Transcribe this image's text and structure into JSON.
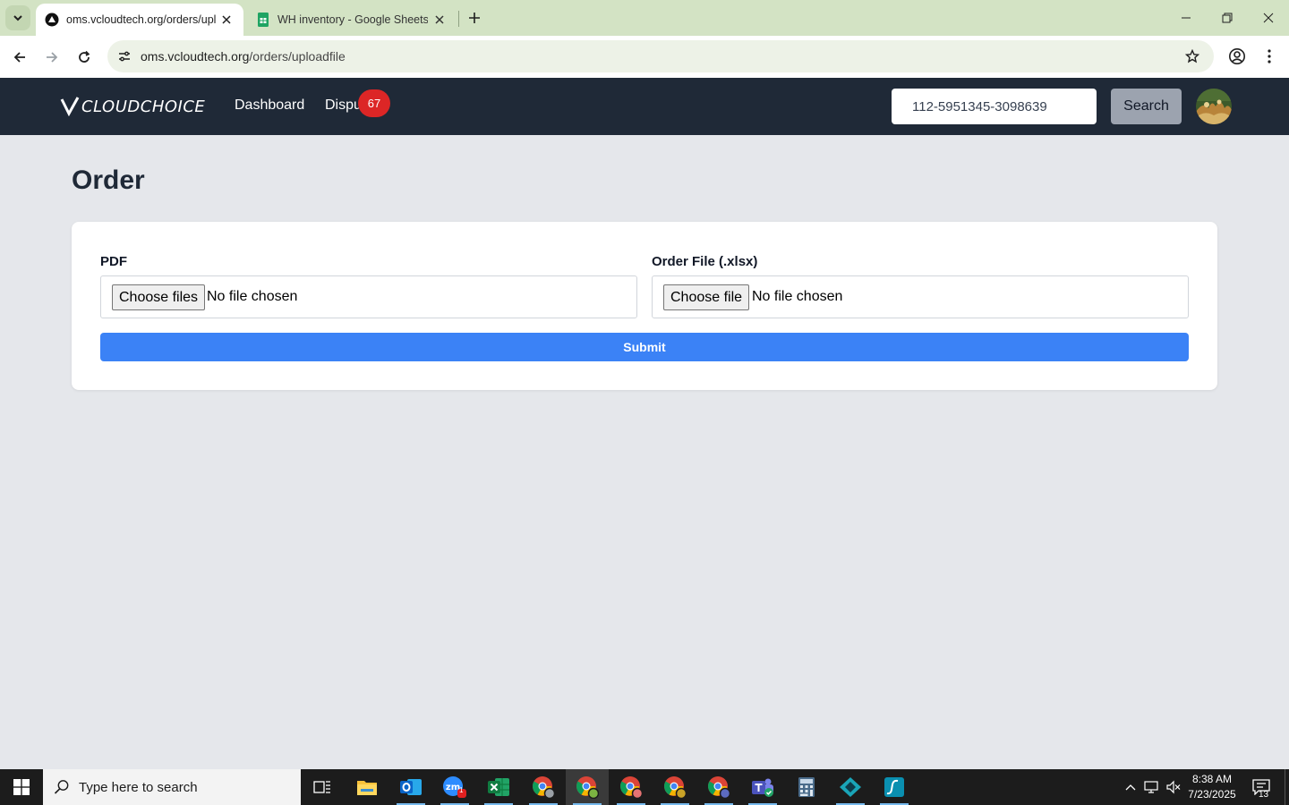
{
  "browser": {
    "tabs": [
      {
        "title": "oms.vcloudtech.org/orders/upl",
        "active": true
      },
      {
        "title": "WH inventory - Google Sheets",
        "active": false
      }
    ],
    "url_host": "oms.vcloudtech.org",
    "url_path": "/orders/uploadfile"
  },
  "appnav": {
    "logo_text": "CLOUDCHOICE",
    "links": [
      "Dashboard",
      "Disputes"
    ],
    "disputes_visible": "Dispu",
    "disputes_badge": "67",
    "search_value": "112-5951345-3098639",
    "search_button": "Search"
  },
  "main": {
    "title": "Order",
    "pdf_label": "PDF",
    "pdf_button": "Choose files",
    "pdf_status": "No file chosen",
    "order_label": "Order File (.xlsx)",
    "order_button": "Choose file",
    "order_status": "No file chosen",
    "submit_label": "Submit"
  },
  "taskbar": {
    "search_placeholder": "Type here to search",
    "time": "8:38 AM",
    "date": "7/23/2025",
    "notification_count": "13",
    "zoom_badge": "1",
    "apps": [
      "task-view",
      "file-explorer",
      "outlook",
      "zoom",
      "excel",
      "chrome-profile-1",
      "chrome-profile-2",
      "chrome-profile-3",
      "chrome-profile-4",
      "chrome-profile-5",
      "teams",
      "calculator",
      "vpn-app",
      "sublime-app"
    ]
  },
  "colors": {
    "nav_bg": "#1f2937",
    "page_bg": "#e5e7eb",
    "submit_blue": "#3b82f6",
    "badge_red": "#dc2626",
    "tabstrip_green": "#d3e3c4"
  }
}
